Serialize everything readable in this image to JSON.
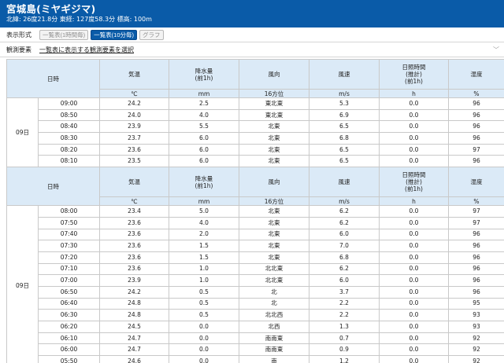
{
  "station": {
    "name": "宮城島(ミヤギジマ)",
    "coords": "北緯: 26度21.8分 東経: 127度58.3分 標高: 100m"
  },
  "controls": {
    "display_format_label": "表示形式",
    "buttons": [
      "一覧表(1時間毎)",
      "一覧表(10分毎)",
      "グラフ"
    ],
    "active_button": "一覧表(10分毎)",
    "element_label": "観測要素",
    "element_select_text": "一覧表に表示する観測要素を選択"
  },
  "table": {
    "columns": [
      {
        "name": "日時",
        "unit": ""
      },
      {
        "name": "気温",
        "unit": "℃"
      },
      {
        "name": [
          "降水量",
          "(前1h)"
        ],
        "unit": "mm"
      },
      {
        "name": "風向",
        "unit": "16方位"
      },
      {
        "name": "風速",
        "unit": "m/s"
      },
      {
        "name": [
          "日照時間",
          "(推計)",
          "(前1h)"
        ],
        "unit": "h"
      },
      {
        "name": "湿度",
        "unit": "%"
      }
    ],
    "groups": [
      {
        "day": "09日",
        "rows": [
          [
            "09:00",
            "24.2",
            "2.5",
            "東北東",
            "5.3",
            "0.0",
            "96"
          ],
          [
            "08:50",
            "24.0",
            "4.0",
            "東北東",
            "6.9",
            "0.0",
            "96"
          ],
          [
            "08:40",
            "23.9",
            "5.5",
            "北東",
            "6.5",
            "0.0",
            "96"
          ],
          [
            "08:30",
            "23.7",
            "6.0",
            "北東",
            "6.8",
            "0.0",
            "96"
          ],
          [
            "08:20",
            "23.6",
            "6.0",
            "北東",
            "6.5",
            "0.0",
            "97"
          ],
          [
            "08:10",
            "23.5",
            "6.0",
            "北東",
            "6.5",
            "0.0",
            "96"
          ]
        ]
      },
      {
        "day": "09日",
        "rows": [
          [
            "08:00",
            "23.4",
            "5.0",
            "北東",
            "6.2",
            "0.0",
            "97"
          ],
          [
            "07:50",
            "23.6",
            "4.0",
            "北東",
            "6.2",
            "0.0",
            "97"
          ],
          [
            "07:40",
            "23.6",
            "2.0",
            "北東",
            "6.0",
            "0.0",
            "96"
          ],
          [
            "07:30",
            "23.6",
            "1.5",
            "北東",
            "7.0",
            "0.0",
            "96"
          ],
          [
            "07:20",
            "23.6",
            "1.5",
            "北東",
            "6.8",
            "0.0",
            "96"
          ],
          [
            "07:10",
            "23.6",
            "1.0",
            "北北東",
            "6.2",
            "0.0",
            "96"
          ],
          [
            "07:00",
            "23.9",
            "1.0",
            "北北東",
            "6.0",
            "0.0",
            "96"
          ],
          [
            "06:50",
            "24.2",
            "0.5",
            "北",
            "3.7",
            "0.0",
            "96"
          ],
          [
            "06:40",
            "24.8",
            "0.5",
            "北",
            "2.2",
            "0.0",
            "95"
          ],
          [
            "06:30",
            "24.8",
            "0.5",
            "北北西",
            "2.2",
            "0.0",
            "93"
          ],
          [
            "06:20",
            "24.5",
            "0.0",
            "北西",
            "1.3",
            "0.0",
            "93"
          ],
          [
            "06:10",
            "24.7",
            "0.0",
            "南南東",
            "0.7",
            "0.0",
            "92"
          ],
          [
            "06:00",
            "24.7",
            "0.0",
            "南南東",
            "0.9",
            "0.0",
            "92"
          ],
          [
            "05:50",
            "24.6",
            "0.0",
            "南",
            "1.2",
            "0.0",
            "92"
          ]
        ]
      }
    ]
  }
}
